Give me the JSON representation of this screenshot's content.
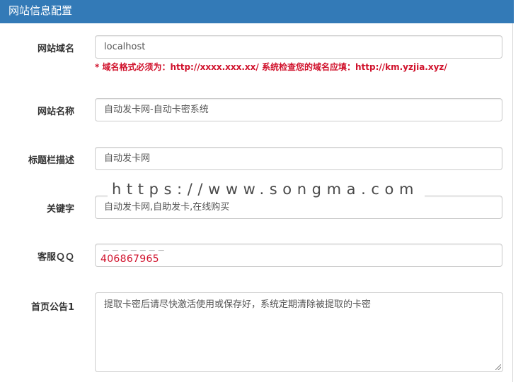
{
  "panel": {
    "title": "网站信息配置"
  },
  "fields": [
    {
      "label": "网站域名",
      "value": "localhost"
    },
    {
      "label": "网站名称",
      "value": "自动发卡网-自动卡密系统"
    },
    {
      "label": "标题栏描述",
      "value": "自动发卡网"
    },
    {
      "label": "关键字",
      "value": "自动发卡网,自助发卡,在线购买"
    },
    {
      "label": "客服ＱＱ",
      "value": "406867965"
    },
    {
      "label": "首页公告1",
      "value": "提取卡密后请尽快激活使用或保存好，系统定期清除被提取的卡密"
    }
  ],
  "domain_hint": "* 域名格式必须为：http://xxxx.xxx.xx/ 系统检查您的域名应填：http://km.yzjia.xyz/",
  "watermark": "https://www.songma.com",
  "colors": {
    "header_bg": "#337ab7",
    "hint": "#d0112b"
  }
}
